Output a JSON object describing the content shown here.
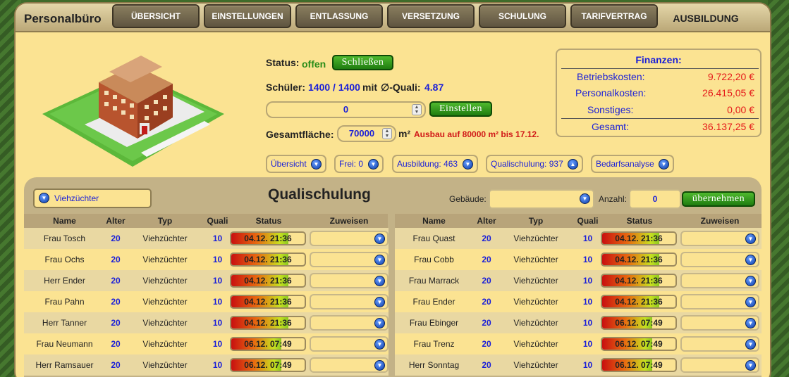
{
  "app": {
    "title": "Personalbüro"
  },
  "tabs": [
    {
      "label": "ÜBERSICHT"
    },
    {
      "label": "EINSTELLUNGEN"
    },
    {
      "label": "ENTLASSUNG"
    },
    {
      "label": "VERSETZUNG"
    },
    {
      "label": "SCHULUNG"
    },
    {
      "label": "TARIFVERTRAG"
    },
    {
      "label": "AUSBILDUNG"
    }
  ],
  "info": {
    "status_label": "Status:",
    "status_value": "offen",
    "close_button": "Schließen",
    "students_label": "Schüler:",
    "students_value": "1400 / 1400",
    "mit": "mit",
    "avg_label": "∅-Quali:",
    "avg_value": "4.87",
    "hire_value": "0",
    "hire_button": "Einstellen",
    "area_label": "Gesamtfläche:",
    "area_value": "70000",
    "area_unit": "m²",
    "expansion_note": "Ausbau auf 80000 m² bis 17.12."
  },
  "finances": {
    "title": "Finanzen:",
    "rows": [
      {
        "label": "Betriebskosten:",
        "value": "9.722,20 €"
      },
      {
        "label": "Personalkosten:",
        "value": "26.415,05 €"
      },
      {
        "label": "Sonstiges:",
        "value": "0,00 €"
      },
      {
        "label": "Gesamt:",
        "value": "36.137,25 €"
      }
    ]
  },
  "filters": [
    {
      "label": "Übersicht"
    },
    {
      "label": "Frei: 0"
    },
    {
      "label": "Ausbildung: 463"
    },
    {
      "label": "Qualischulung: 937"
    },
    {
      "label": "Bedarfsanalyse"
    }
  ],
  "panel": {
    "type_select": "Viehzüchter",
    "title": "Qualischulung",
    "building_label": "Gebäude:",
    "building_value": "",
    "count_label": "Anzahl:",
    "count_value": "0",
    "apply_button": "übernehmen"
  },
  "columns": [
    "Name",
    "Alter",
    "Typ",
    "Quali",
    "Status",
    "Zuweisen"
  ],
  "left_rows": [
    {
      "name": "Frau Tosch",
      "age": "20",
      "type": "Viehzüchter",
      "quali": "10",
      "status": "04.12. 21:36",
      "progress": 0.78
    },
    {
      "name": "Frau Ochs",
      "age": "20",
      "type": "Viehzüchter",
      "quali": "10",
      "status": "04.12. 21:36",
      "progress": 0.78
    },
    {
      "name": "Herr Ender",
      "age": "20",
      "type": "Viehzüchter",
      "quali": "10",
      "status": "04.12. 21:36",
      "progress": 0.78
    },
    {
      "name": "Frau Pahn",
      "age": "20",
      "type": "Viehzüchter",
      "quali": "10",
      "status": "04.12. 21:36",
      "progress": 0.78
    },
    {
      "name": "Herr Tanner",
      "age": "20",
      "type": "Viehzüchter",
      "quali": "10",
      "status": "04.12. 21:36",
      "progress": 0.78
    },
    {
      "name": "Frau Neumann",
      "age": "20",
      "type": "Viehzüchter",
      "quali": "10",
      "status": "06.12. 07:49",
      "progress": 0.68
    },
    {
      "name": "Herr Ramsauer",
      "age": "20",
      "type": "Viehzüchter",
      "quali": "10",
      "status": "06.12. 07:49",
      "progress": 0.68
    }
  ],
  "right_rows": [
    {
      "name": "Frau Quast",
      "age": "20",
      "type": "Viehzüchter",
      "quali": "10",
      "status": "04.12. 21:36",
      "progress": 0.78
    },
    {
      "name": "Frau Cobb",
      "age": "20",
      "type": "Viehzüchter",
      "quali": "10",
      "status": "04.12. 21:36",
      "progress": 0.78
    },
    {
      "name": "Frau Marrack",
      "age": "20",
      "type": "Viehzüchter",
      "quali": "10",
      "status": "04.12. 21:36",
      "progress": 0.78
    },
    {
      "name": "Frau Ender",
      "age": "20",
      "type": "Viehzüchter",
      "quali": "10",
      "status": "04.12. 21:36",
      "progress": 0.78
    },
    {
      "name": "Frau Ebinger",
      "age": "20",
      "type": "Viehzüchter",
      "quali": "10",
      "status": "06.12. 07:49",
      "progress": 0.68
    },
    {
      "name": "Frau Trenz",
      "age": "20",
      "type": "Viehzüchter",
      "quali": "10",
      "status": "06.12. 07:49",
      "progress": 0.68
    },
    {
      "name": "Herr Sonntag",
      "age": "20",
      "type": "Viehzüchter",
      "quali": "10",
      "status": "06.12. 07:49",
      "progress": 0.68
    }
  ]
}
